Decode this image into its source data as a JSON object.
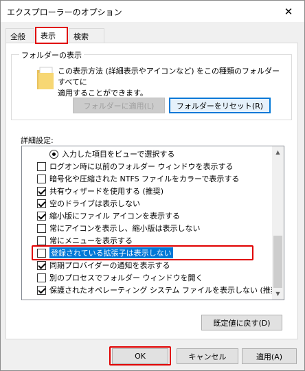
{
  "window": {
    "title": "エクスプローラーのオプション",
    "close_glyph": "✕"
  },
  "tabs": [
    {
      "label": "全般",
      "active": false
    },
    {
      "label": "表示",
      "active": true
    },
    {
      "label": "検索",
      "active": false
    }
  ],
  "folder_view": {
    "group_title": "フォルダーの表示",
    "description_line1": "この表示方法 (詳細表示やアイコンなど) をこの種類のフォルダーすべてに",
    "description_line2": "適用することができます。",
    "apply_button": "フォルダーに適用(L)",
    "reset_button": "フォルダーをリセット(R)"
  },
  "advanced": {
    "label": "詳細設定:",
    "items": [
      {
        "type": "radio",
        "checked": true,
        "label": "入力した項目をビューで選択する"
      },
      {
        "type": "checkbox",
        "checked": false,
        "label": "ログオン時に以前のフォルダー ウィンドウを表示する"
      },
      {
        "type": "checkbox",
        "checked": false,
        "label": "暗号化や圧縮された NTFS ファイルをカラーで表示する"
      },
      {
        "type": "checkbox",
        "checked": true,
        "label": "共有ウィザードを使用する (推奨)"
      },
      {
        "type": "checkbox",
        "checked": true,
        "label": "空のドライブは表示しない"
      },
      {
        "type": "checkbox",
        "checked": true,
        "label": "縮小版にファイル アイコンを表示する"
      },
      {
        "type": "checkbox",
        "checked": false,
        "label": "常にアイコンを表示し、縮小版は表示しない"
      },
      {
        "type": "checkbox",
        "checked": false,
        "label": "常にメニューを表示する"
      },
      {
        "type": "checkbox",
        "checked": false,
        "label": "登録されている拡張子は表示しない",
        "selected": true
      },
      {
        "type": "checkbox",
        "checked": true,
        "label": "同期プロバイダーの通知を表示する"
      },
      {
        "type": "checkbox",
        "checked": false,
        "label": "別のプロセスでフォルダー ウィンドウを開く"
      },
      {
        "type": "checkbox",
        "checked": true,
        "label": "保護されたオペレーティング システム ファイルを表示しない (推奨)"
      }
    ],
    "restore_defaults_button": "既定値に戻す(D)"
  },
  "footer": {
    "ok": "OK",
    "cancel": "キャンセル",
    "apply": "適用(A)"
  },
  "colors": {
    "highlight_red": "#e00000",
    "selection_blue": "#0078d7"
  }
}
